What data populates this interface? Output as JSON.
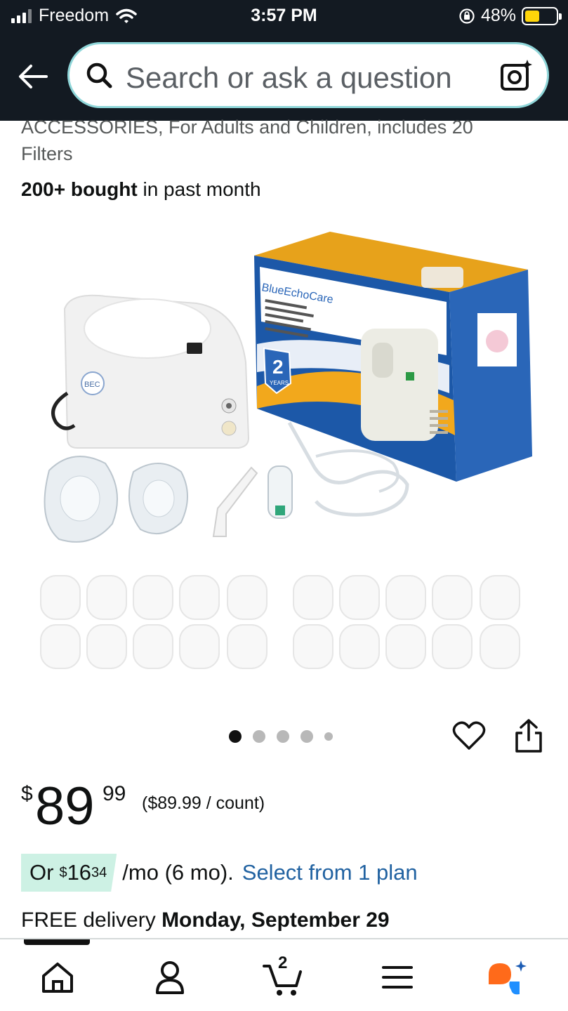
{
  "status_bar": {
    "carrier": "Freedom",
    "time": "3:57 PM",
    "battery_percent": "48%"
  },
  "header": {
    "search_placeholder": "Search or ask a question"
  },
  "product": {
    "title_tail_line1": "ACCESSORIES, For Adults and Children, includes 20",
    "title_tail_line2": "Filters",
    "bought_bold": "200+ bought",
    "bought_rest": " in past month",
    "image_dots": 5,
    "active_image_index": 0
  },
  "pricing": {
    "currency": "$",
    "whole": "89",
    "fraction": "99",
    "unit_price": "($89.99 / count)"
  },
  "installment": {
    "prefix": "Or",
    "currency": "$",
    "whole": "16",
    "fraction": "34",
    "term": "/mo (6 mo).",
    "link": "Select from 1 plan"
  },
  "delivery": {
    "prefix": "FREE delivery ",
    "date": "Monday, September 29"
  },
  "bottom_nav": {
    "cart_count": "2",
    "items": [
      "home-icon",
      "account-icon",
      "cart-icon",
      "menu-icon",
      "rufus-icon"
    ]
  },
  "image_text": {
    "brand": "BlueEchoCare",
    "logo": "BEC",
    "warranty_number": "2",
    "warranty_unit": "YEARS"
  },
  "colors": {
    "header_bg": "#131a22",
    "search_border": "#8fd6d9",
    "link": "#2162a1",
    "installment_chip": "#cdf1e4",
    "battery": "#ffd60a",
    "box_blue": "#1c58a8",
    "box_orange": "#f0a21a"
  }
}
